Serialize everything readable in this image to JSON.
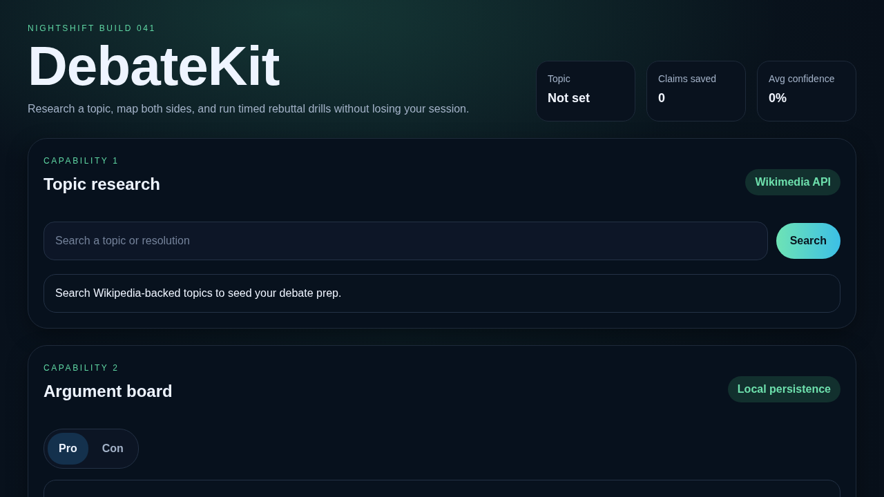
{
  "header": {
    "eyebrow": "NIGHTSHIFT BUILD 041",
    "title": "DebateKit",
    "subtitle": "Research a topic, map both sides, and run timed rebuttal drills without losing your session."
  },
  "stats": [
    {
      "label": "Topic",
      "value": "Not set"
    },
    {
      "label": "Claims saved",
      "value": "0"
    },
    {
      "label": "Avg confidence",
      "value": "0%"
    }
  ],
  "capabilities": [
    {
      "kind": "research",
      "eyebrow": "CAPABILITY 1",
      "title": "Topic research",
      "badge": "Wikimedia API",
      "search": {
        "placeholder": "Search a topic or resolution",
        "button": "Search"
      },
      "message": "Search Wikipedia-backed topics to seed your debate prep."
    },
    {
      "kind": "board",
      "eyebrow": "CAPABILITY 2",
      "title": "Argument board",
      "badge": "Local persistence",
      "sides": [
        {
          "label": "Pro",
          "selected": true
        },
        {
          "label": "Con",
          "selected": false
        }
      ]
    }
  ]
}
